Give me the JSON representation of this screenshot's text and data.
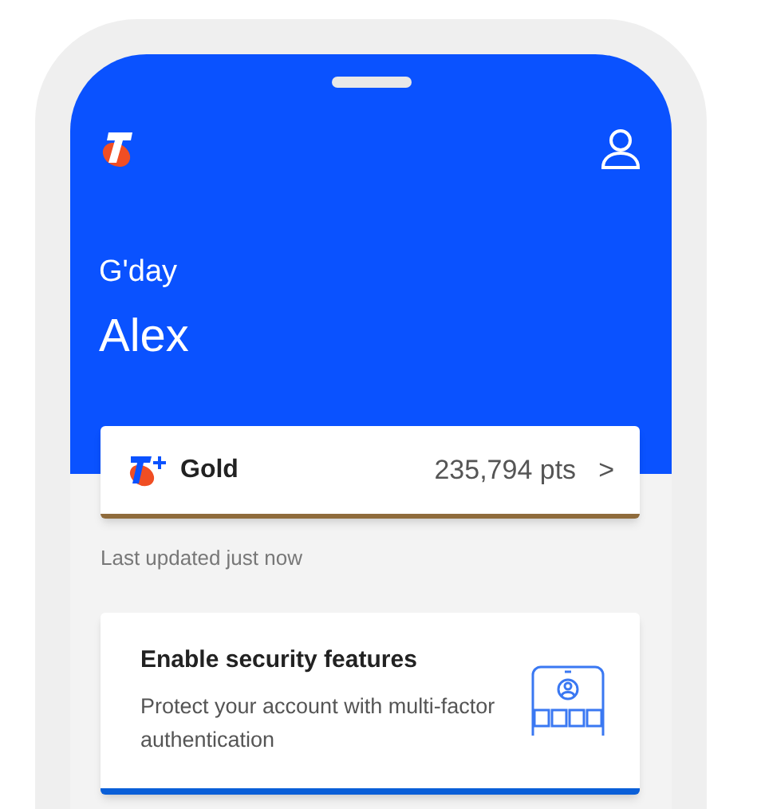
{
  "header": {
    "greeting": "G'day",
    "name": "Alex"
  },
  "rewards_card": {
    "tier": "Gold",
    "points": "235,794 pts",
    "chevron": ">"
  },
  "last_updated": "Last updated just now",
  "security_card": {
    "title": "Enable security features",
    "description": "Protect your account with multi-factor authentication"
  }
}
